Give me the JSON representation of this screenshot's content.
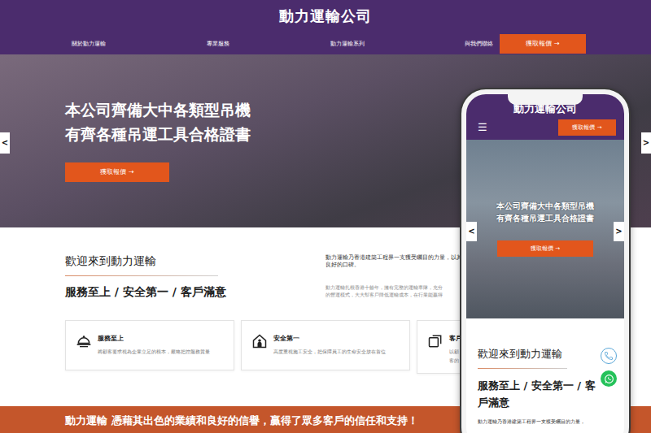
{
  "header": {
    "title": "動力運輸公司"
  },
  "nav": {
    "items": [
      "關於動力運輸",
      "專業服務",
      "動力運輸系列",
      "與我們聯絡"
    ],
    "cta": "獲取報價 →"
  },
  "hero": {
    "lines": [
      "本公司齊備大中各類型吊機",
      "有齊各種吊運工具合格證書"
    ],
    "button": "獲取報價 →",
    "prev": "<",
    "next": ">"
  },
  "welcome": {
    "title": "歡迎來到動力運輸",
    "subtitle": "服務至上 / 安全第一 /  客戶滿意",
    "intro": [
      "動力運輸乃香港建築工程界一支獲受矚目的力量，以其卓",
      "良好的口碑。"
    ],
    "detail": [
      "動力運輸扎根香港十餘年，擁有完整的運輸車隊，充分",
      "的營運模式，大大幫客戶降低運輸成本，在行業能贏得"
    ]
  },
  "features": [
    {
      "title": "服務至上",
      "desc": [
        "將顧客要求視為企業立足的根本，嚴格把控服務質量"
      ]
    },
    {
      "title": "安全第一",
      "desc": [
        "高度重視施工安全，把保障員工的生命安全放在首位"
      ]
    },
    {
      "title": "客戶",
      "desc": [
        "以顧",
        "客的"
      ]
    }
  ],
  "banner": {
    "text": "動力運輸 憑藉其出色的業績和良好的信譽，贏得了眾多客戶的信任和支持！"
  },
  "phone": {
    "title": "動力運輸公司",
    "menu": "☰",
    "cta": "獲取報價 →",
    "hero_lines": [
      "本公司齊備大中各類型吊機",
      "有齊各種吊運工具合格證書"
    ],
    "button": "獲取報價 →",
    "prev": "<",
    "next": ">",
    "welcome_title": "歡迎來到動力運輸",
    "subtitle": "服務至上 / 安全第一 / 客戶滿意",
    "intro": "動力運輸乃香港建築工程界一支獲受矚目的力量，"
  }
}
